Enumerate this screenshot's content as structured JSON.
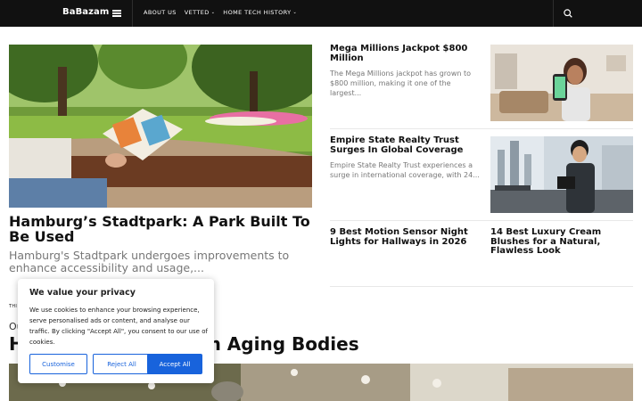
{
  "header": {
    "logo": "BaBazam",
    "nav": [
      {
        "label": "ABOUT US",
        "dropdown": false
      },
      {
        "label": "VETTED",
        "dropdown": true
      },
      {
        "label": "HOME TECH HISTORY",
        "dropdown": true
      }
    ],
    "search_icon": "search-icon",
    "menu_icon": "hamburger-menu-icon"
  },
  "hero": {
    "title": "Hamburg’s Stadtpark: A Park Built To Be Used",
    "excerpt": "Hamburg's Stadtpark undergoes improvements to enhance accessibility and usage,..."
  },
  "articles": [
    {
      "title": "Mega Millions Jackpot $800 Million",
      "excerpt": "The Mega Millions jackpot has grown to $800 million, making it one of the largest..."
    },
    {
      "title": "Empire State Realty Trust Surges In Global Coverage",
      "excerpt": "Empire State Realty Trust experiences a surge in international coverage, with 24..."
    },
    {
      "title": "9 Best Motion Sensor Night Lights for Hallways in 2026",
      "excerpt": ""
    },
    {
      "title": "14 Best Luxury Cream Blushes for a Natural, Flawless Look",
      "excerpt": ""
    }
  ],
  "section": {
    "label": "THI",
    "subtitle": "Ou",
    "title": "H                        ard Work Easier on Aging Bodies"
  },
  "cookie": {
    "title": "We value your privacy",
    "text": "We use cookies to enhance your browsing experience, serve personalised ads or content, and analyse our traffic. By clicking \"Accept All\", you consent to our use of cookies.",
    "customise": "Customise",
    "reject": "Reject All",
    "accept": "Accept All"
  },
  "colors": {
    "header_bg": "#111111",
    "accent": "#1863dc",
    "excerpt": "#777777"
  }
}
